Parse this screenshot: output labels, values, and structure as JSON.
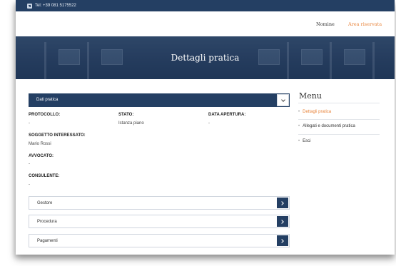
{
  "topbar": {
    "phone_text": "Tel: +39 081 5175522"
  },
  "nav": {
    "items": [
      {
        "label": "Nomine"
      },
      {
        "label": "Area riservata",
        "color": "#e8833a"
      }
    ]
  },
  "hero": {
    "title": "Dettagli pratica"
  },
  "panel": {
    "title": "Dati pratica",
    "fields": {
      "protocollo": {
        "label": "PROTOCOLLO:",
        "value": "-"
      },
      "stato": {
        "label": "STATO:",
        "value": "Istanza piano"
      },
      "data_apertura": {
        "label": "DATA APERTURA:",
        "value": "-"
      },
      "soggetto": {
        "label": "SOGGETTO INTERESSATO:",
        "value": "Mario Rossi"
      },
      "avvocato": {
        "label": "AVVOCATO:",
        "value": "-"
      },
      "consulente": {
        "label": "CONSULENTE:",
        "value": "-"
      }
    }
  },
  "accordions": [
    {
      "label": "Gestore"
    },
    {
      "label": "Procedura"
    },
    {
      "label": "Pagamenti"
    }
  ],
  "menu": {
    "title": "Menu",
    "items": [
      {
        "label": "Dettagli pratica",
        "active": true
      },
      {
        "label": "Allegati e documenti pratica",
        "active": false
      },
      {
        "label": "Esci",
        "active": false
      }
    ]
  },
  "colors": {
    "primary": "#243f63",
    "accent": "#e8833a"
  }
}
